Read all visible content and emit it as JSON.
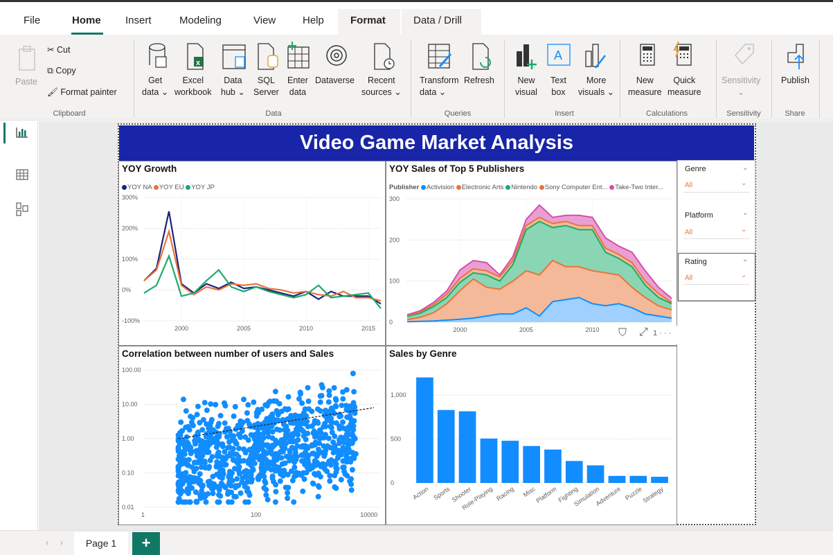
{
  "tabs": [
    "File",
    "Home",
    "Insert",
    "Modeling",
    "View",
    "Help",
    "Format",
    "Data / Drill"
  ],
  "ribbon": {
    "clipboard": {
      "paste": "Paste",
      "cut": "Cut",
      "copy": "Copy",
      "format_painter": "Format painter",
      "label": "Clipboard"
    },
    "data": {
      "get_data_1": "Get",
      "get_data_2": "data ⌄",
      "excel_1": "Excel",
      "excel_2": "workbook",
      "hub_1": "Data",
      "hub_2": "hub ⌄",
      "sql_1": "SQL",
      "sql_2": "Server",
      "enter_1": "Enter",
      "enter_2": "data",
      "dataverse": "Dataverse",
      "recent_1": "Recent",
      "recent_2": "sources ⌄",
      "label": "Data"
    },
    "queries": {
      "transform_1": "Transform",
      "transform_2": "data ⌄",
      "refresh": "Refresh",
      "label": "Queries"
    },
    "insert": {
      "new_visual_1": "New",
      "new_visual_2": "visual",
      "text_box_1": "Text",
      "text_box_2": "box",
      "more_visuals_1": "More",
      "more_visuals_2": "visuals ⌄",
      "label": "Insert"
    },
    "calculations": {
      "new_measure_1": "New",
      "new_measure_2": "measure",
      "quick_measure_1": "Quick",
      "quick_measure_2": "measure",
      "label": "Calculations"
    },
    "sensitivity": {
      "btn": "Sensitivity",
      "btn_2": "⌄",
      "label": "Sensitivity"
    },
    "share": {
      "publish": "Publish",
      "label": "Share"
    }
  },
  "report": {
    "title": "Video Game Market Analysis",
    "yoy": {
      "title": "YOY Growth",
      "legend": [
        "YOY NA",
        "YOY EU",
        "YOY JP"
      ],
      "colors": [
        "#1a237e",
        "#e8743b",
        "#1aab6b"
      ],
      "yticks": [
        "300%",
        "200%",
        "100%",
        "0%",
        "-100%"
      ],
      "xticks": [
        "2000",
        "2005",
        "2010",
        "2015"
      ]
    },
    "publishers": {
      "title": "YOY Sales of Top 5 Publishers",
      "legend_label": "Publisher",
      "legend": [
        "Activision",
        "Electronic Arts",
        "Nintendo",
        "Sony Computer Ent...",
        "Take-Two Inter..."
      ],
      "colors": [
        "#118dff",
        "#e8743b",
        "#1aab6b",
        "#e8743b",
        "#d64fa7"
      ],
      "yticks": [
        "300",
        "200",
        "100",
        "0"
      ],
      "xticks": [
        "2000",
        "2005",
        "2010"
      ]
    },
    "scatter": {
      "title": "Correlation between number of users and Sales",
      "yticks": [
        "100.00",
        "10.00",
        "1.00",
        "0.10",
        "0.01"
      ],
      "xticks": [
        "1",
        "100",
        "10000"
      ]
    },
    "genre": {
      "title": "Sales by Genre",
      "yticks": [
        "1,000",
        "500",
        "0"
      ]
    },
    "slicers": [
      {
        "title": "Genre",
        "value": "All"
      },
      {
        "title": "Platform",
        "value": "All"
      },
      {
        "title": "Rating",
        "value": "All"
      }
    ],
    "focus_more": "1 · · ·"
  },
  "chart_data": [
    {
      "type": "line",
      "title": "YOY Growth",
      "x": [
        1997,
        1998,
        1999,
        2000,
        2001,
        2002,
        2003,
        2004,
        2005,
        2006,
        2007,
        2008,
        2009,
        2010,
        2011,
        2012,
        2013,
        2014,
        2015,
        2016
      ],
      "ylim": [
        -100,
        300
      ],
      "series": [
        {
          "name": "YOY NA",
          "values": [
            30,
            70,
            255,
            20,
            -10,
            20,
            5,
            25,
            5,
            10,
            0,
            -10,
            -20,
            -5,
            -30,
            -5,
            -20,
            -20,
            -20,
            -45
          ]
        },
        {
          "name": "YOY EU",
          "values": [
            30,
            65,
            190,
            15,
            -15,
            10,
            0,
            20,
            15,
            20,
            5,
            0,
            -10,
            -5,
            -15,
            -20,
            -5,
            -25,
            -25,
            -35
          ]
        },
        {
          "name": "YOY JP",
          "values": [
            -10,
            15,
            110,
            -20,
            -10,
            30,
            65,
            10,
            -5,
            10,
            -5,
            -15,
            -25,
            -15,
            15,
            -25,
            -20,
            -15,
            -10,
            -60
          ]
        }
      ]
    },
    {
      "type": "area",
      "title": "YOY Sales of Top 5 Publishers",
      "x": [
        1996,
        1997,
        1998,
        1999,
        2000,
        2001,
        2002,
        2003,
        2004,
        2005,
        2006,
        2007,
        2008,
        2009,
        2010,
        2011,
        2012,
        2013,
        2014,
        2015,
        2016
      ],
      "ylim": [
        0,
        300
      ],
      "series": [
        {
          "name": "Activision",
          "values": [
            1,
            2,
            3,
            5,
            7,
            10,
            15,
            20,
            20,
            35,
            15,
            50,
            55,
            60,
            45,
            40,
            45,
            35,
            20,
            15,
            10
          ]
        },
        {
          "name": "Electronic Arts",
          "values": [
            5,
            10,
            20,
            40,
            70,
            95,
            70,
            60,
            80,
            90,
            100,
            100,
            80,
            75,
            80,
            80,
            70,
            50,
            40,
            25,
            20
          ]
        },
        {
          "name": "Nintendo",
          "values": [
            8,
            10,
            15,
            15,
            20,
            15,
            30,
            20,
            40,
            100,
            130,
            80,
            100,
            90,
            100,
            50,
            40,
            50,
            30,
            20,
            15
          ]
        },
        {
          "name": "Sony Computer Entertainment",
          "values": [
            2,
            3,
            5,
            8,
            10,
            10,
            10,
            10,
            10,
            10,
            10,
            10,
            10,
            10,
            10,
            10,
            10,
            10,
            10,
            10,
            3
          ]
        },
        {
          "name": "Take-Two Interactive",
          "values": [
            2,
            3,
            5,
            8,
            20,
            20,
            20,
            5,
            10,
            15,
            30,
            15,
            15,
            25,
            20,
            25,
            20,
            25,
            25,
            15,
            10
          ]
        }
      ]
    },
    {
      "type": "scatter",
      "title": "Correlation between number of users and Sales",
      "x_scale": "log",
      "y_scale": "log",
      "xlim": [
        1,
        20000
      ],
      "ylim": [
        0.01,
        100
      ],
      "trendline": {
        "x": [
          4,
          15000
        ],
        "y": [
          1,
          8
        ]
      }
    },
    {
      "type": "bar",
      "title": "Sales by Genre",
      "categories": [
        "Action",
        "Sports",
        "Shooter",
        "Role-Playing",
        "Racing",
        "Misc",
        "Platform",
        "Fighting",
        "Simulation",
        "Adventure",
        "Puzzle",
        "Strategy"
      ],
      "values": [
        1200,
        830,
        815,
        505,
        480,
        420,
        380,
        250,
        200,
        80,
        80,
        70
      ],
      "ylim": [
        0,
        1300
      ]
    }
  ]
}
